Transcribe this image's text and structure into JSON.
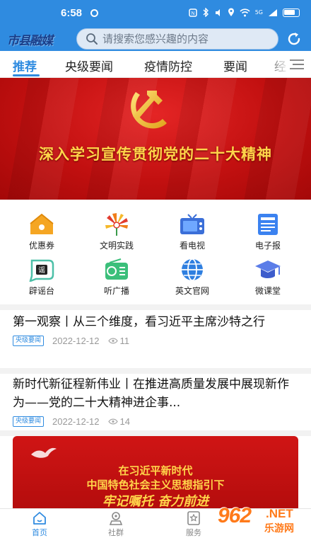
{
  "status_bar": {
    "time": "6:58",
    "network": "5G"
  },
  "header": {
    "logo_text": "市县融媒",
    "search_placeholder": "请搜索您感兴趣的内容"
  },
  "tabs": [
    {
      "label": "推荐",
      "active": true
    },
    {
      "label": "央级要闻"
    },
    {
      "label": "疫情防控"
    },
    {
      "label": "要闻"
    },
    {
      "label": "经"
    }
  ],
  "banner": {
    "slogan": "深入学习宣传贯彻党的二十大精神"
  },
  "grid": [
    {
      "label": "优惠券",
      "icon": "house-coupon-icon"
    },
    {
      "label": "文明实践",
      "icon": "flower-icon"
    },
    {
      "label": "看电视",
      "icon": "tv-icon"
    },
    {
      "label": "电子报",
      "icon": "newspaper-icon"
    },
    {
      "label": "辟谣台",
      "icon": "rumor-icon"
    },
    {
      "label": "听广播",
      "icon": "radio-icon"
    },
    {
      "label": "英文官网",
      "icon": "globe-icon"
    },
    {
      "label": "微课堂",
      "icon": "graduation-cap-icon"
    }
  ],
  "articles": [
    {
      "title": "第一观察丨从三个维度，看习近平主席沙特之行",
      "badge": "央级要闻",
      "date": "2022-12-12",
      "views": "11"
    },
    {
      "title": "新时代新征程新伟业丨在推进高质量发展中展现新作为——党的二十大精神进企事...",
      "badge": "央级要闻",
      "date": "2022-12-12",
      "views": "14"
    }
  ],
  "image_card": {
    "line1": "在习近平新时代",
    "line2": "中国特色社会主义思想指引下",
    "line3": "牢记嘱托 奋力前进"
  },
  "bottom_nav": [
    {
      "label": "首页",
      "active": true
    },
    {
      "label": "社群"
    },
    {
      "label": "服务"
    }
  ],
  "watermark": {
    "number": "962",
    "suffix": ".NET",
    "cn": "乐游网"
  },
  "colors": {
    "primary": "#2f8be0",
    "banner_red": "#c21010",
    "slogan_gold": "#ffd54a"
  }
}
